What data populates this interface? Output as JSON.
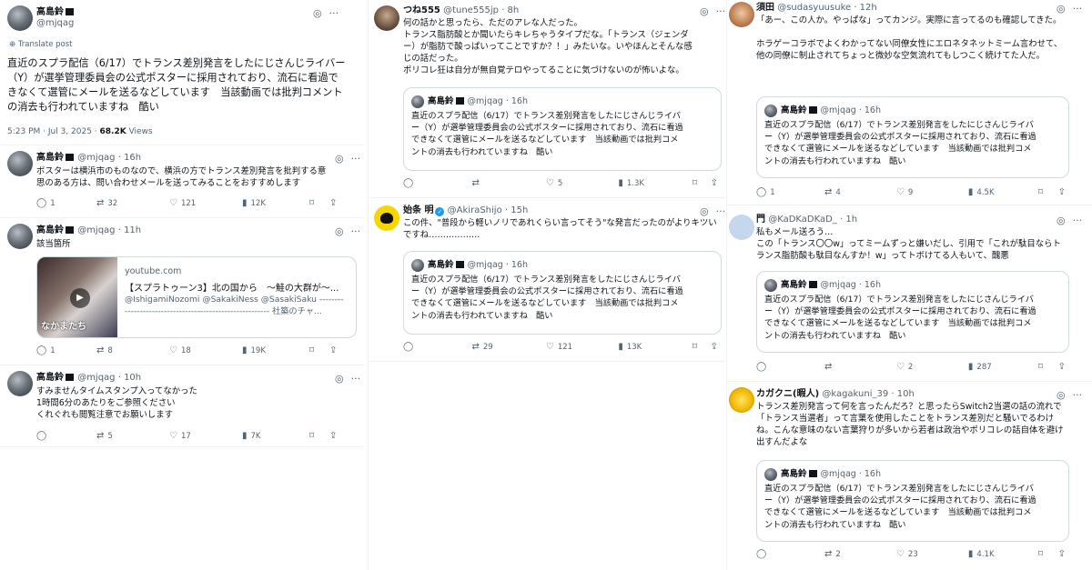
{
  "icons": {
    "grok": "◎",
    "more": "···",
    "reply": "◯",
    "retweet": "⇄",
    "like": "♡",
    "views": "▮",
    "bookmark": "⌑",
    "share": "⇪"
  },
  "col1": {
    "main": {
      "name": "高島鈴",
      "handle": "@mjqag",
      "translate": "Translate post",
      "text": "直近のスプラ配信（6/17）でトランス差別発言をしたにじさんじライバー\n（Y）が選挙管理委員会の公式ポスターに採用されており、流石に看過で\nきなくて選管にメールを送るなどしています　当該動画では批判コメント\nの消去も行われていますね　酷い",
      "time": "5:23 PM · Jul 3, 2025 · ",
      "views": "68.2K",
      "views_label": " Views"
    },
    "replies": [
      {
        "name": "高島鈴",
        "handle": "@mjqag · 16h",
        "text": "ポスターは横浜市のものなので、横浜の方でトランス差別発言を批判する意\n思のある方は、問い合わせメールを送ってみることをおすすめします",
        "reply": "1",
        "retweet": "32",
        "like": "121",
        "views": "12K"
      },
      {
        "name": "高島鈴",
        "handle": "@mjqag · 11h",
        "text": "該当箇所",
        "reply": "1",
        "retweet": "8",
        "like": "18",
        "views": "19K",
        "card": {
          "domain": "youtube.com",
          "title": "【スプラトゥーン3】北の国から　〜鮭の大群が〜...",
          "desc": "@IshigamiNozomi @SakakiNess @SasakiSaku --------\n------------------------------------------------ 社築のチャ...",
          "stamp": "なかまたち"
        }
      },
      {
        "name": "高島鈴",
        "handle": "@mjqag · 10h",
        "text": "すみませんタイムスタンプ入ってなかった\n1時間6分のあたりをご参照ください\nくれぐれも閲覧注意でお願いします",
        "reply": "",
        "retweet": "5",
        "like": "17",
        "views": "7K"
      }
    ]
  },
  "col2": [
    {
      "name": "つね555",
      "handle": "@tune555jp · 8h",
      "text": "何の話かと思ったら、ただのアレな人だった。\nトランス脂肪酸とか聞いたらキレちゃうタイプだな。「トランス（ジェンダ\nー）が脂肪で酸っぱいってことですか？！」みたいな。いやほんとそんな感\nじの話だった。\nポリコレ狂は自分が無自覚テロやってることに気づけないのが怖いよな。",
      "reply": "",
      "retweet": "",
      "like": "5",
      "views": "1.3K"
    },
    {
      "name": "始条 明",
      "handle": "@AkiraShijo · 15h",
      "text": "この件、\"普段から軽いノリであれくらい言ってそう\"な発言だったのがよりキツいですね………………",
      "reply": "",
      "retweet": "29",
      "like": "121",
      "views": "13K"
    }
  ],
  "col3": [
    {
      "name": "須田",
      "handle": "@sudasyuusuke · 12h",
      "text": "「あー、この人か。やっぱな」ってカンジ。実際に言ってるのも確認してきた。\n\nホラゲーコラボでよくわかってない同僚女性にエロネタネットミーム言わせて、他の同僚に制止されてちょっと微妙な空気流れてもしつこく続けてた人だ。",
      "reply": "1",
      "retweet": "4",
      "like": "9",
      "views": "4.5K"
    },
    {
      "name": "門",
      "handle": "@KaDKaDKaD_ · 1h",
      "text": "私もメール送ろう…\nこの「トランス〇〇w」ってミームずっと嫌いだし、引用で「これが駄目ならトランス脂肪酸も駄目なんすか！w」ってトボけてる人もいて、醜悪",
      "reply": "",
      "retweet": "",
      "like": "2",
      "views": "287"
    },
    {
      "name": "カガクニ(暇人)",
      "handle": "@kagakuni_39 · 10h",
      "text": "トランス差別発言って何を言ったんだろ？と思ったらSwitch2当選の話の流れで「トランス当選者」って言葉を使用したことをトランス差別だと騒いでるわけね。こんな意味のない言葉狩りが多いから若者は政治やポリコレの話自体を避け出すんだよな",
      "reply": "",
      "retweet": "2",
      "like": "23",
      "views": "4.1K"
    }
  ],
  "quote": {
    "name": "高島鈴",
    "handle": "@mjqag · 16h",
    "text": "直近のスプラ配信（6/17）でトランス差別発言をしたにじさんじライバ\nー（Y）が選挙管理委員会の公式ポスターに採用されており、流石に看過\nできなくて選管にメールを送るなどしています　当該動画では批判コメ\nントの消去も行われていますね　酷い"
  }
}
